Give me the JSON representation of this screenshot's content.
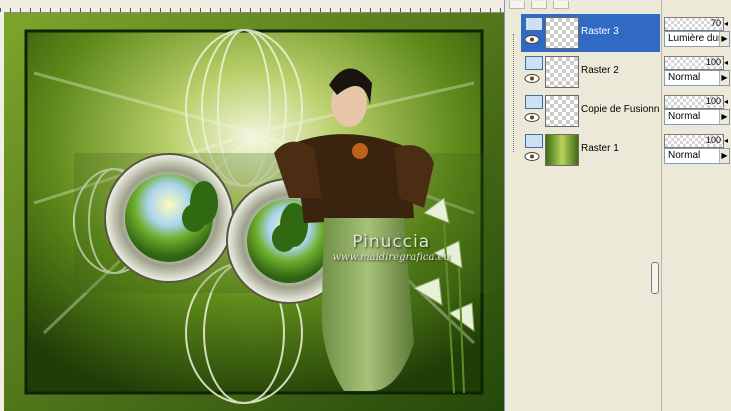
{
  "watermark": {
    "name": "Pinuccia",
    "url": "www.maidiregrafica.eu"
  },
  "layers": [
    {
      "name": "Raster 3",
      "selected": true,
      "opacity": "70",
      "blend": "Lumière dure"
    },
    {
      "name": "Raster 2",
      "selected": false,
      "opacity": "100",
      "blend": "Normal"
    },
    {
      "name": "Copie de Fusionn",
      "selected": false,
      "opacity": "100",
      "blend": "Normal"
    },
    {
      "name": "Raster 1",
      "selected": false,
      "opacity": "100",
      "blend": "Normal"
    }
  ],
  "colors": {
    "selection": "#316ac5",
    "panel": "#ece9d8",
    "accent_green": "#6f9e1c"
  }
}
